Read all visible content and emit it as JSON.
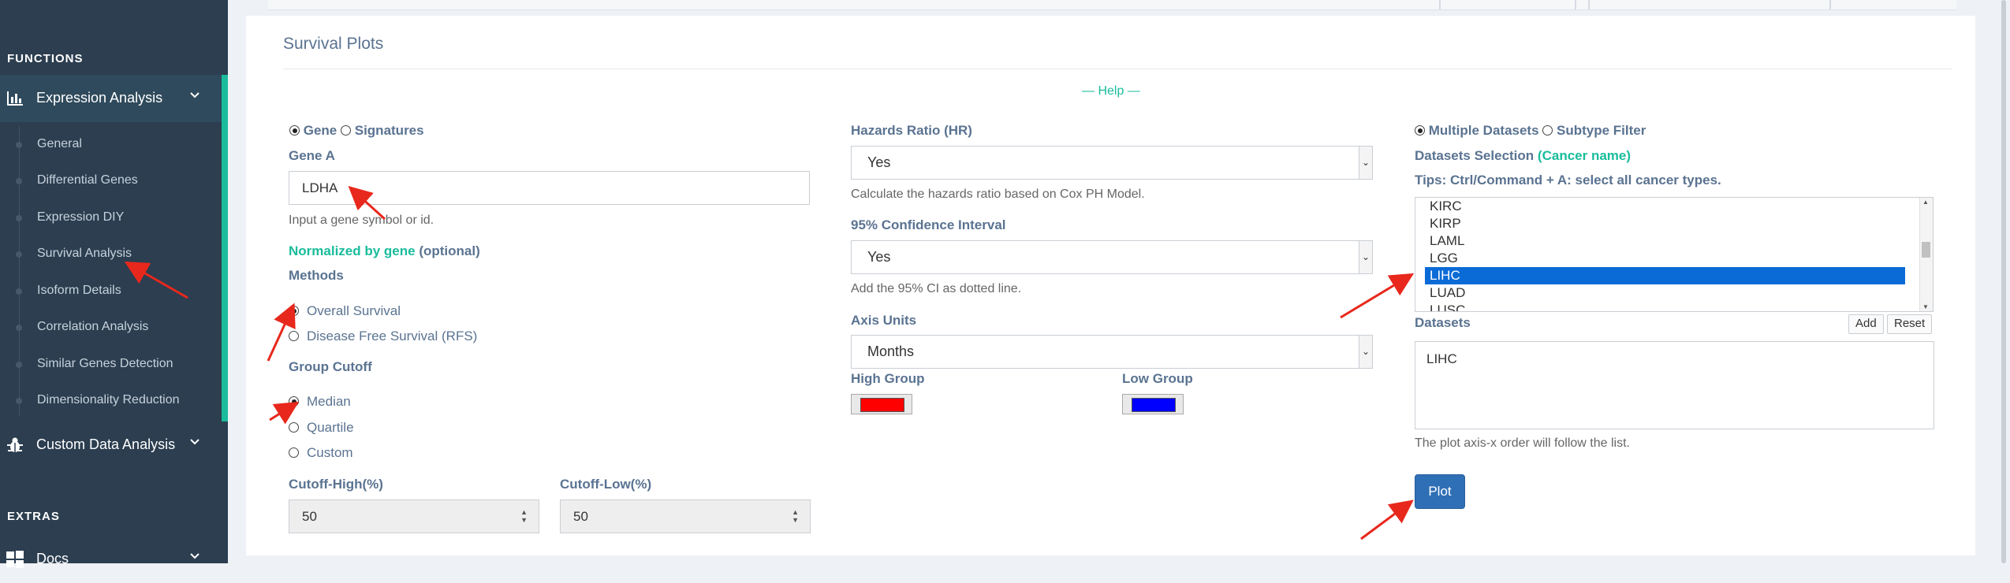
{
  "sidebar": {
    "functions_heading": "FUNCTIONS",
    "extras_heading": "EXTRAS",
    "expression_analysis": "Expression Analysis",
    "submenu": [
      "General",
      "Differential Genes",
      "Expression DIY",
      "Survival Analysis",
      "Isoform Details",
      "Correlation Analysis",
      "Similar Genes Detection",
      "Dimensionality Reduction"
    ],
    "custom_data_analysis": "Custom Data Analysis",
    "docs": "Docs"
  },
  "card": {
    "title": "Survival Plots",
    "help": "— Help —"
  },
  "left": {
    "gene_option": "Gene",
    "signatures_option": "Signatures",
    "gene_a_label": "Gene A",
    "gene_a_value": "LDHA",
    "gene_a_hint": "Input a gene symbol or id.",
    "normalized_label": "Normalized by gene",
    "optional": "(optional)",
    "methods_label": "Methods",
    "methods": [
      "Overall Survival",
      "Disease Free Survival (RFS)"
    ],
    "group_cutoff_label": "Group Cutoff",
    "cutoffs": [
      "Median",
      "Quartile",
      "Custom"
    ],
    "cutoff_high_label": "Cutoff-High(%)",
    "cutoff_high_value": "50",
    "cutoff_low_label": "Cutoff-Low(%)",
    "cutoff_low_value": "50"
  },
  "middle": {
    "hr_label": "Hazards Ratio (HR)",
    "hr_value": "Yes",
    "hr_hint": "Calculate the hazards ratio based on Cox PH Model.",
    "ci_label": "95% Confidence Interval",
    "ci_value": "Yes",
    "ci_hint": "Add the 95% CI as dotted line.",
    "axis_units_label": "Axis Units",
    "axis_units_value": "Months",
    "high_group_label": "High Group",
    "high_group_color": "#ff0000",
    "low_group_label": "Low Group",
    "low_group_color": "#0000ff"
  },
  "right": {
    "multiple_datasets": "Multiple Datasets",
    "subtype_filter": "Subtype Filter",
    "datasets_selection_label": "Datasets Selection",
    "cancer_name": "(Cancer name)",
    "tips": "Tips: Ctrl/Command + A: select all cancer types.",
    "dataset_options": [
      "KIRC",
      "KIRP",
      "LAML",
      "LGG",
      "LIHC",
      "LUAD",
      "LUSC"
    ],
    "selected_dataset": "LIHC",
    "datasets_label": "Datasets",
    "add_button": "Add",
    "reset_button": "Reset",
    "datasets_value": "LIHC",
    "order_hint": "The plot axis-x order will follow the list.",
    "plot_button": "Plot"
  },
  "colors": {
    "sidebar_bg": "#2c3e50",
    "accent_green": "#1abc9c",
    "plot_button": "#2f6fb5",
    "annotation_arrow": "#e8281c"
  }
}
